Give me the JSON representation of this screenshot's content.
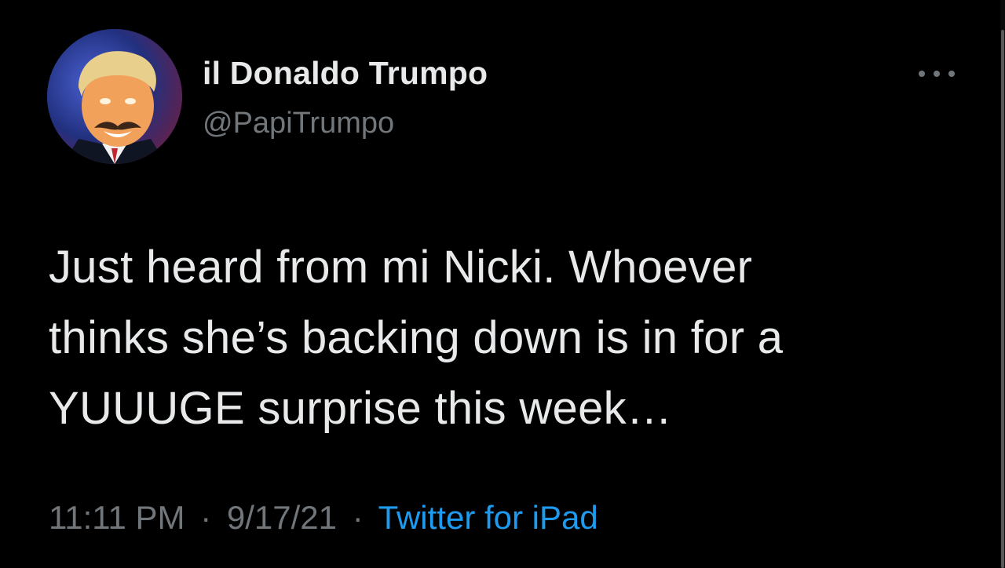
{
  "author": {
    "display_name": "il Donaldo Trumpo",
    "handle": "@PapiTrumpo",
    "avatar_icon": "profile-photo"
  },
  "tweet": {
    "text_lines": [
      "Just heard from mi Nicki. Whoever",
      "thinks she’s backing down is in for a",
      "YUUUGE surprise this week…"
    ]
  },
  "meta": {
    "time": "11:11 PM",
    "date": "9/17/21",
    "separator": "·",
    "source": "Twitter for iPad"
  },
  "icons": {
    "more": "more-options-icon"
  },
  "colors": {
    "background": "#000000",
    "primary_text": "#e7e9ea",
    "secondary_text": "#71767b",
    "link": "#1d9bf0"
  }
}
